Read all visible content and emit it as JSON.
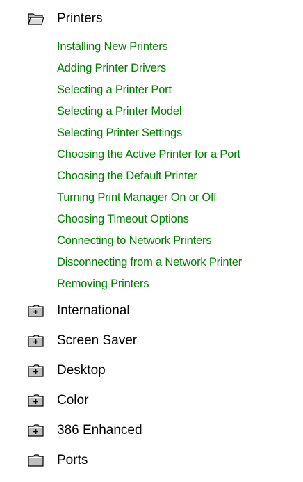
{
  "tree": {
    "open_folder": {
      "label": "Printers",
      "icon": "open-folder-icon",
      "topics": [
        "Installing New Printers",
        "Adding Printer Drivers",
        "Selecting a Printer Port",
        "Selecting a Printer Model",
        "Selecting Printer Settings",
        "Choosing the Active Printer for a Port",
        "Choosing the Default Printer",
        "Turning Print Manager On or Off",
        "Choosing Timeout Options",
        "Connecting to Network Printers",
        "Disconnecting from a Network Printer",
        "Removing Printers"
      ]
    },
    "closed_folders": [
      {
        "label": "International",
        "icon": "plus-folder-icon"
      },
      {
        "label": "Screen Saver",
        "icon": "plus-folder-icon"
      },
      {
        "label": "Desktop",
        "icon": "plus-folder-icon"
      },
      {
        "label": "Color",
        "icon": "plus-folder-icon"
      },
      {
        "label": "386 Enhanced",
        "icon": "plus-folder-icon"
      },
      {
        "label": "Ports",
        "icon": "folder-icon"
      }
    ]
  },
  "colors": {
    "topic_link": "#008000",
    "folder_label": "#000000",
    "folder_fill": "#c0c0c0",
    "folder_outline": "#000000"
  }
}
